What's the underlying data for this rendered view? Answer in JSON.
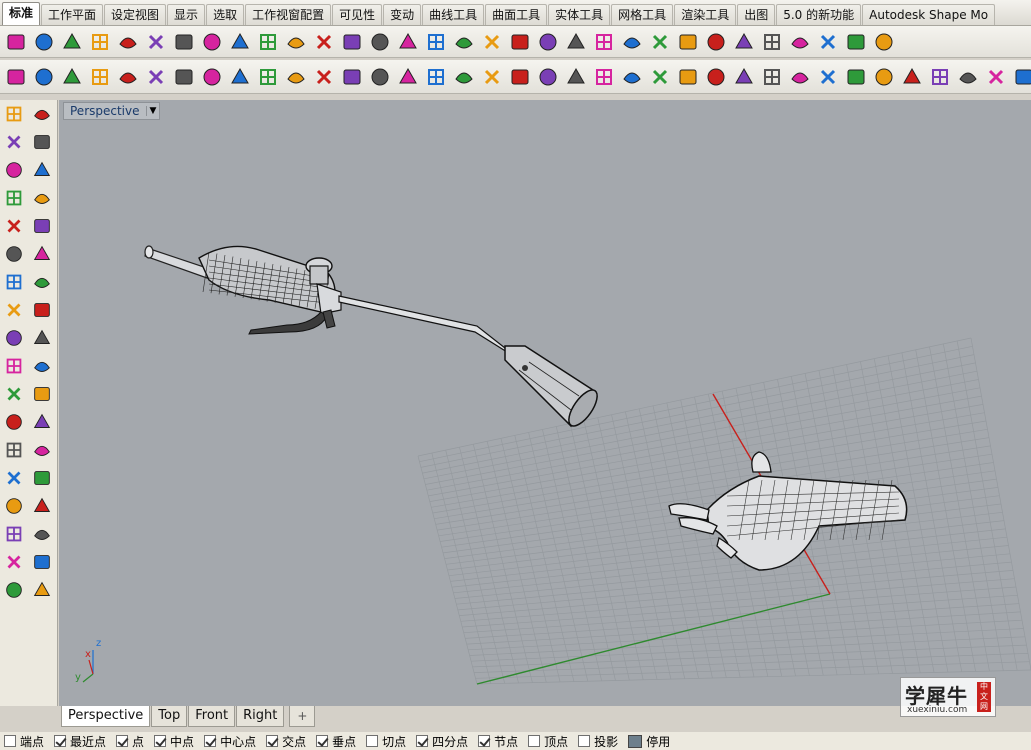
{
  "tabs": [
    "标准",
    "工作平面",
    "设定视图",
    "显示",
    "选取",
    "工作视窗配置",
    "可见性",
    "变动",
    "曲线工具",
    "曲面工具",
    "实体工具",
    "网格工具",
    "渲染工具",
    "出图",
    "5.0 的新功能",
    "Autodesk Shape Mo"
  ],
  "active_tab": "标准",
  "toolbar1_icons": [
    "new-file-icon",
    "open-folder-icon",
    "save-icon",
    "print-icon",
    "import-icon",
    "cut-icon",
    "copy-icon",
    "paste-icon",
    "undo-icon",
    "pan-hand-icon",
    "rotate-view-icon",
    "zoom-icon",
    "zoom-window-icon",
    "zoom-extents-icon",
    "zoom-selected-icon",
    "undo-view-icon",
    "four-viewports-icon",
    "car-icon",
    "hide-icon",
    "grid-snap-icon",
    "select-points-icon",
    "light-bulb-icon",
    "lock-icon",
    "layer-icon",
    "color-wheel-icon",
    "shaded-sphere-icon",
    "ghosted-sphere-icon",
    "rendered-sphere-icon",
    "render-icon",
    "settings-gear-icon",
    "options-icon",
    "help-icon"
  ],
  "toolbar2_icons": [
    "power-icon",
    "surface-from-curves-icon",
    "surface-box-icon",
    "blend-icon",
    "network-icon",
    "cage-icon",
    "extend-icon",
    "fillet-icon",
    "match-icon",
    "merge-icon",
    "rebuild-icon",
    "split-icon",
    "trim-icon",
    "offset-icon",
    "unroll-icon",
    "loft-icon",
    "sweep-icon",
    "patch-icon",
    "edge-icon",
    "planar-icon",
    "revolve-icon",
    "rail-icon",
    "grid-icon",
    "select-cube-icon",
    "cap-icon",
    "cross-icon",
    "extract-icon",
    "flow-icon",
    "twist-icon",
    "bend-icon",
    "taper-icon",
    "shear-icon",
    "smooth-icon",
    "points-grid-icon",
    "curve-on-surface-icon",
    "mesh-icon",
    "branch-icon",
    "chain-icon",
    "diamond-icon",
    "target-icon",
    "star-icon"
  ],
  "left_toolbar_icons": [
    "select-arrow-icon",
    "point-icon",
    "polyline-icon",
    "curve-points-icon",
    "circle-icon",
    "ellipse-icon",
    "arc-icon",
    "rectangle-icon",
    "polygon-icon",
    "fillet-curve-icon",
    "surface-icon",
    "surface-edit-icon",
    "box-icon",
    "sphere-icon",
    "cylinder-icon",
    "plane-icon",
    "boolean-icon",
    "explode-icon",
    "trim-icon",
    "project-icon",
    "group-icon",
    "mirror-icon",
    "offset-curve-icon",
    "fillet-edge-icon",
    "text-icon",
    "scale-icon",
    "array-icon",
    "align-icon",
    "block-icon",
    "hatch-icon",
    "points-icon",
    "dimension-icon",
    "curve-tool-icon",
    "check-icon",
    "cage-edit-icon",
    "solid-tool-icon"
  ],
  "viewport": {
    "title": "Perspective",
    "background": "#a4a8ad",
    "grid_color": "#9da2a7",
    "x_axis_color": "#c8201c",
    "y_axis_color": "#2e8a2e"
  },
  "axis_labels": {
    "x": "x",
    "y": "y",
    "z": "z"
  },
  "watermark": {
    "text": "学犀牛",
    "seal": "中文网",
    "url": "xuexiniu.com"
  },
  "viewport_tabs": [
    "Perspective",
    "Top",
    "Front",
    "Right"
  ],
  "active_viewport_tab": "Perspective",
  "add_tab_label": "+",
  "osnaps": [
    {
      "label": "端点",
      "checked": false
    },
    {
      "label": "最近点",
      "checked": true
    },
    {
      "label": "点",
      "checked": true
    },
    {
      "label": "中点",
      "checked": true
    },
    {
      "label": "中心点",
      "checked": true
    },
    {
      "label": "交点",
      "checked": true
    },
    {
      "label": "垂点",
      "checked": true
    },
    {
      "label": "切点",
      "checked": false
    },
    {
      "label": "四分点",
      "checked": true
    },
    {
      "label": "节点",
      "checked": true
    },
    {
      "label": "顶点",
      "checked": false
    },
    {
      "label": "投影",
      "checked": false
    }
  ],
  "disable_label": "停用"
}
